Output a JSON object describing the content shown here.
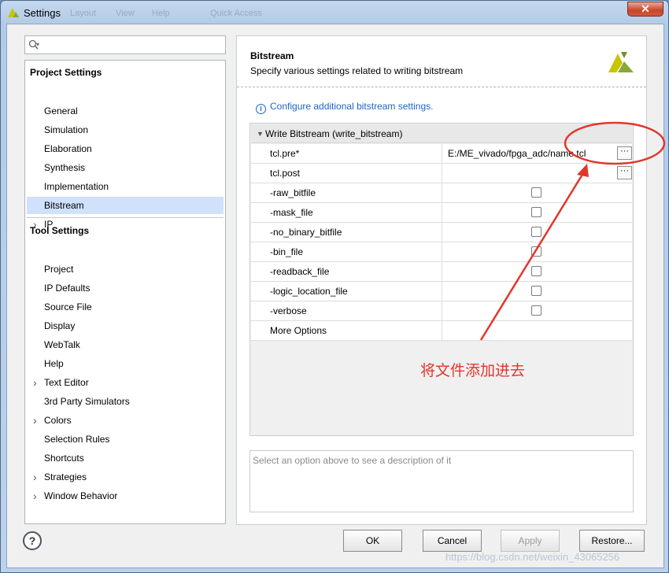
{
  "window": {
    "title": "Settings",
    "close_label": "✕",
    "ghost_menu": [
      "Layout",
      "View",
      "Help",
      "Quick Access"
    ]
  },
  "search": {
    "placeholder": ""
  },
  "tree": {
    "project_settings_label": "Project Settings",
    "project_items": [
      {
        "label": "General",
        "expandable": false
      },
      {
        "label": "Simulation",
        "expandable": false
      },
      {
        "label": "Elaboration",
        "expandable": false
      },
      {
        "label": "Synthesis",
        "expandable": false
      },
      {
        "label": "Implementation",
        "expandable": false
      },
      {
        "label": "Bitstream",
        "expandable": false,
        "selected": true
      },
      {
        "label": "IP",
        "expandable": true
      }
    ],
    "tool_settings_label": "Tool Settings",
    "tool_items": [
      {
        "label": "Project",
        "expandable": false
      },
      {
        "label": "IP Defaults",
        "expandable": false
      },
      {
        "label": "Source File",
        "expandable": false
      },
      {
        "label": "Display",
        "expandable": false
      },
      {
        "label": "WebTalk",
        "expandable": false
      },
      {
        "label": "Help",
        "expandable": false
      },
      {
        "label": "Text Editor",
        "expandable": true
      },
      {
        "label": "3rd Party Simulators",
        "expandable": false
      },
      {
        "label": "Colors",
        "expandable": true
      },
      {
        "label": "Selection Rules",
        "expandable": false
      },
      {
        "label": "Shortcuts",
        "expandable": false
      },
      {
        "label": "Strategies",
        "expandable": true
      },
      {
        "label": "Window Behavior",
        "expandable": true
      }
    ]
  },
  "panel": {
    "title": "Bitstream",
    "subtitle": "Specify various settings related to writing bitstream",
    "info_link": "Configure additional bitstream settings.",
    "group_label": "Write Bitstream (write_bitstream)",
    "rows": [
      {
        "name": "tcl.pre*",
        "type": "file",
        "value": "E:/ME_vivado/fpga_adc/name.tcl"
      },
      {
        "name": "tcl.post",
        "type": "file",
        "value": ""
      },
      {
        "name": "-raw_bitfile",
        "type": "checkbox",
        "checked": false
      },
      {
        "name": "-mask_file",
        "type": "checkbox",
        "checked": false
      },
      {
        "name": "-no_binary_bitfile",
        "type": "checkbox",
        "checked": false
      },
      {
        "name": "-bin_file",
        "type": "checkbox",
        "checked": false
      },
      {
        "name": "-readback_file",
        "type": "checkbox",
        "checked": false
      },
      {
        "name": "-logic_location_file",
        "type": "checkbox",
        "checked": false
      },
      {
        "name": "-verbose",
        "type": "checkbox",
        "checked": false
      },
      {
        "name": "More Options",
        "type": "text",
        "value": ""
      }
    ],
    "description_placeholder": "Select an option above to see a description of it"
  },
  "footer": {
    "help_label": "?",
    "ok_label": "OK",
    "cancel_label": "Cancel",
    "apply_label": "Apply",
    "restore_label": "Restore..."
  },
  "annotation": {
    "text": "将文件添加进去",
    "color": "#e2362b"
  },
  "watermark": "https://blog.csdn.net/weixin_43065256",
  "colors": {
    "selection": "#cfe1fb",
    "link": "#1d64c8",
    "logo_yellow": "#c8c400",
    "logo_green": "#6e8f2a"
  }
}
